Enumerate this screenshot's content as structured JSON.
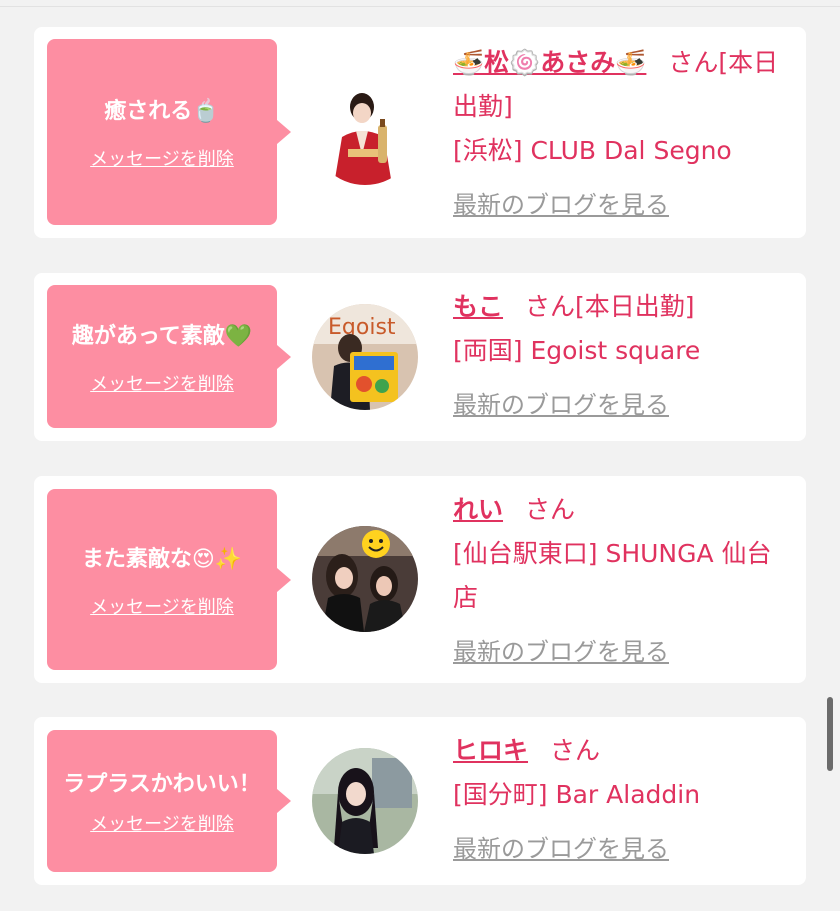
{
  "delete_label": "メッセージを削除",
  "blog_label": "最新のブログを見る",
  "honorific": "さん",
  "cards": [
    {
      "message": "癒される🍵",
      "name": "🍜松🍥あさみ🍜",
      "suffix": "[本日出勤]",
      "shop": "[浜松] CLUB Dal Segno"
    },
    {
      "message": "趣があって素敵💚",
      "name": "もこ",
      "suffix": "[本日出勤]",
      "shop": "[両国] Egoist square"
    },
    {
      "message": "また素敵な😍✨",
      "name": "れい",
      "suffix": "",
      "shop": "[仙台駅東口] SHUNGA 仙台店"
    },
    {
      "message": "ラプラスかわいい！",
      "name": "ヒロキ",
      "suffix": "",
      "shop": "[国分町] Bar Aladdin"
    }
  ],
  "avatar_photos": {
    "card0": "woman-in-red-kimono-with-bottle",
    "card1": "person-with-egoist-snack-box",
    "card2": "two-women-with-smiley-sticker",
    "card3": "woman-with-long-black-hair-outdoors"
  },
  "colors": {
    "accent": "#e0325f",
    "bubble": "#fd8ea2",
    "link_gray": "#9a9a9a",
    "background": "#f2f2f2"
  }
}
